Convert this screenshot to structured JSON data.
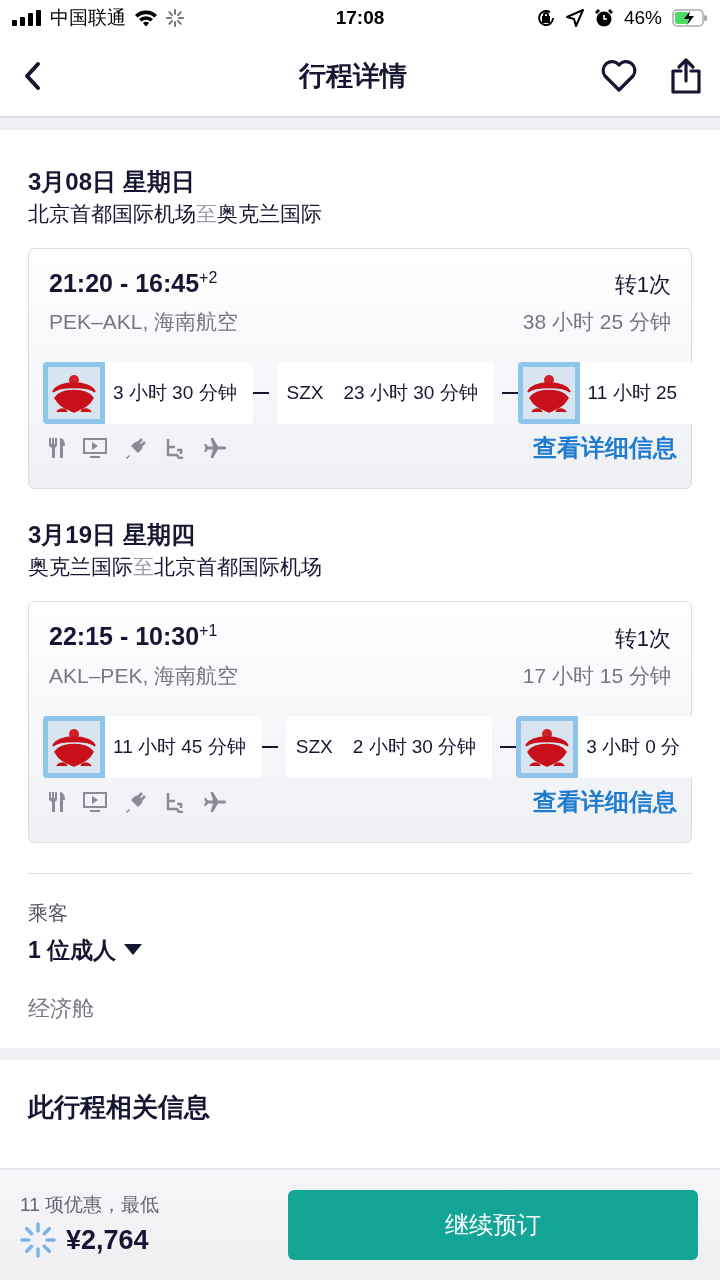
{
  "status_bar": {
    "carrier": "中国联通",
    "time": "17:08",
    "battery": "46%"
  },
  "header": {
    "title": "行程详情"
  },
  "legs": [
    {
      "date": "3月08日 星期日",
      "from": "北京首都国际机场",
      "connector": "至",
      "to": "奥克兰国际",
      "times": "21:20 - 16:45$^{+2}$",
      "stops": "转1次",
      "route": "PEK–AKL, 海南航空",
      "total": "38 小时 25 分钟",
      "segments": [
        {
          "kind": "flight",
          "duration": "3 小时 30 分钟"
        },
        {
          "kind": "stop",
          "airport": "SZX",
          "duration": "23 小时 30 分钟"
        },
        {
          "kind": "flight",
          "duration": "11 小时 25"
        }
      ],
      "link": "查看详细信息"
    },
    {
      "date": "3月19日 星期四",
      "from": "奥克兰国际",
      "connector": "至",
      "to": "北京首都国际机场",
      "times": "22:15 - 10:30$^{+1}$",
      "stops": "转1次",
      "route": "AKL–PEK, 海南航空",
      "total": "17 小时 15 分钟",
      "segments": [
        {
          "kind": "flight",
          "duration": "11 小时 45 分钟"
        },
        {
          "kind": "stop",
          "airport": "SZX",
          "duration": "2 小时 30 分钟"
        },
        {
          "kind": "flight",
          "duration": "3 小时 0 分"
        }
      ],
      "link": "查看详细信息"
    }
  ],
  "passengers": {
    "label": "乘客",
    "value": "1 位成人",
    "cabin": "经济舱"
  },
  "info_title": "此行程相关信息",
  "footer": {
    "offers": "11 项优惠，最低",
    "price": "¥2,764",
    "button": "继续预订"
  }
}
